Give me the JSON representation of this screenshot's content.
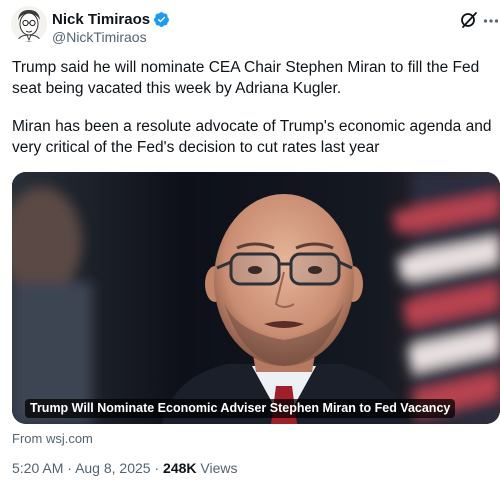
{
  "author": {
    "display_name": "Nick Timiraos",
    "handle": "@NickTimiraos",
    "verified": true,
    "avatar_icon": "sketch-portrait-avatar"
  },
  "header_icons": [
    "grok-icon",
    "more-icon"
  ],
  "tweet": {
    "paragraphs": [
      "Trump said he will nominate CEA Chair Stephen Miran to fill the Fed seat being vacated this week by Adriana Kugler.",
      "Miran has been a resolute advocate of Trump's economic agenda and very critical of the Fed's decision to cut rates last year"
    ]
  },
  "link_card": {
    "title": "Trump Will Nominate Economic Adviser Stephen Miran to Fed Vacancy",
    "source": "From wsj.com"
  },
  "meta": {
    "time": "5:20 AM",
    "separator": "·",
    "date": "Aug 8, 2025",
    "views_count": "248K",
    "views_label": "Views"
  },
  "colors": {
    "text": "#0f1419",
    "secondary": "#536471",
    "verified_blue": "#1d9bf0"
  }
}
